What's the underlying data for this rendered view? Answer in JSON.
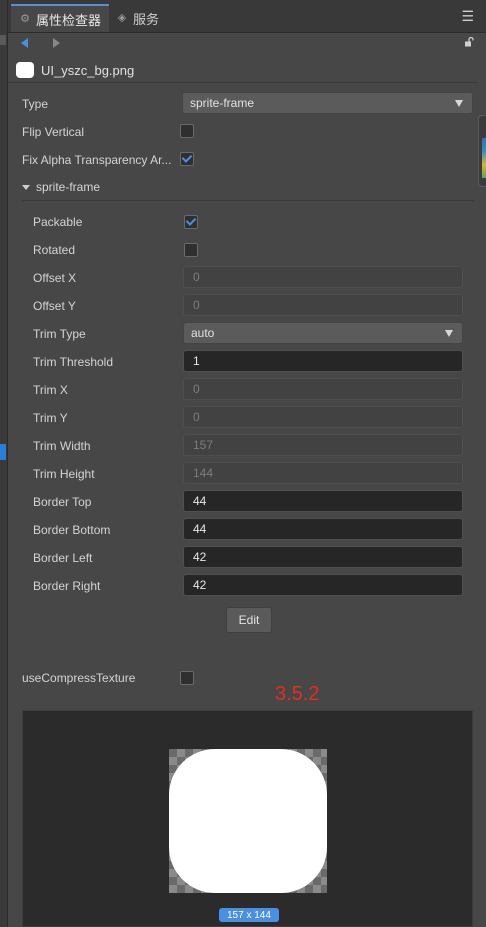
{
  "tabs": [
    {
      "label": "属性检查器",
      "icon": "gear-icon"
    },
    {
      "label": "服务",
      "icon": "eye-icon"
    }
  ],
  "asset": {
    "name": "UI_yszc_bg.png"
  },
  "props": {
    "type_label": "Type",
    "type_value": "sprite-frame",
    "flip_label": "Flip Vertical",
    "flip_checked": false,
    "fixalpha_label": "Fix Alpha Transparency Ar...",
    "fixalpha_checked": true
  },
  "section": {
    "title": "sprite-frame"
  },
  "sprite_frame": {
    "packable_label": "Packable",
    "packable_checked": true,
    "rotated_label": "Rotated",
    "rotated_checked": false,
    "offset_x_label": "Offset X",
    "offset_x": "0",
    "offset_y_label": "Offset Y",
    "offset_y": "0",
    "trim_type_label": "Trim Type",
    "trim_type": "auto",
    "trim_threshold_label": "Trim Threshold",
    "trim_threshold": "1",
    "trim_x_label": "Trim X",
    "trim_x": "0",
    "trim_y_label": "Trim Y",
    "trim_y": "0",
    "trim_width_label": "Trim Width",
    "trim_width": "157",
    "trim_height_label": "Trim Height",
    "trim_height": "144",
    "border_top_label": "Border Top",
    "border_top": "44",
    "border_bottom_label": "Border Bottom",
    "border_bottom": "44",
    "border_left_label": "Border Left",
    "border_left": "42",
    "border_right_label": "Border Right",
    "border_right": "42",
    "edit_label": "Edit"
  },
  "compress": {
    "label": "useCompressTexture",
    "checked": false
  },
  "version_text": "3.5.2",
  "preview": {
    "size_label": "157 x 144"
  },
  "colors": {
    "accent": "#4a90e2",
    "version_red": "#e03020",
    "background": "#474747"
  }
}
